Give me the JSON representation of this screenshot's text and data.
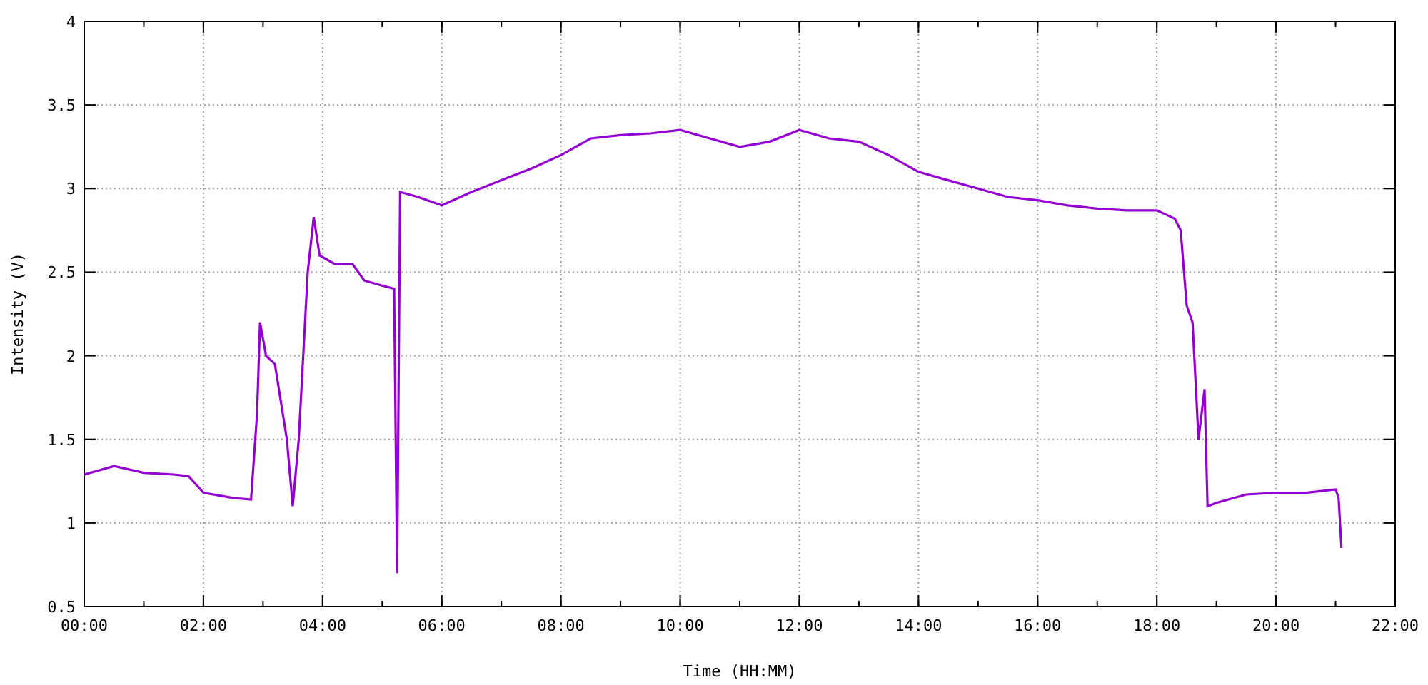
{
  "chart_data": {
    "type": "line",
    "grid": true,
    "xlabel": "Time (HH:MM)",
    "ylabel": "Intensity (V)",
    "x": [
      0,
      0.5,
      1,
      1.5,
      1.75,
      2,
      2.5,
      2.8,
      2.9,
      2.95,
      3.05,
      3.2,
      3.4,
      3.5,
      3.6,
      3.75,
      3.85,
      3.95,
      4.2,
      4.5,
      4.7,
      5,
      5.2,
      5.25,
      5.3,
      5.6,
      6,
      6.5,
      7,
      7.5,
      8,
      8.5,
      9,
      9.5,
      10,
      10.5,
      11,
      11.5,
      12,
      12.5,
      13,
      13.5,
      14,
      14.5,
      15,
      15.5,
      16,
      16.5,
      17,
      17.5,
      18,
      18.3,
      18.4,
      18.5,
      18.6,
      18.7,
      18.8,
      18.85,
      19,
      19.5,
      20,
      20.5,
      21,
      21.05,
      21.1
    ],
    "series": [
      {
        "color": "#9400d3",
        "values": [
          1.29,
          1.34,
          1.3,
          1.29,
          1.28,
          1.18,
          1.15,
          1.14,
          1.65,
          2.2,
          2,
          1.95,
          1.5,
          1.1,
          1.5,
          2.5,
          2.83,
          2.6,
          2.55,
          2.55,
          2.45,
          2.42,
          2.4,
          0.7,
          2.98,
          2.95,
          2.9,
          2.98,
          3.05,
          3.12,
          3.2,
          3.3,
          3.32,
          3.33,
          3.35,
          3.3,
          3.25,
          3.28,
          3.35,
          3.3,
          3.28,
          3.2,
          3.1,
          3.05,
          3,
          2.95,
          2.93,
          2.9,
          2.88,
          2.87,
          2.87,
          2.82,
          2.75,
          2.3,
          2.2,
          1.5,
          1.8,
          1.1,
          1.12,
          1.17,
          1.18,
          1.18,
          1.2,
          1.15,
          0.85
        ]
      }
    ],
    "xlim": [
      0,
      22
    ],
    "ylim": [
      0.5,
      4
    ],
    "xticks": [
      {
        "value": 0,
        "label": "00:00"
      },
      {
        "value": 2,
        "label": "02:00"
      },
      {
        "value": 4,
        "label": "04:00"
      },
      {
        "value": 6,
        "label": "06:00"
      },
      {
        "value": 8,
        "label": "08:00"
      },
      {
        "value": 10,
        "label": "10:00"
      },
      {
        "value": 12,
        "label": "12:00"
      },
      {
        "value": 14,
        "label": "14:00"
      },
      {
        "value": 16,
        "label": "16:00"
      },
      {
        "value": 18,
        "label": "18:00"
      },
      {
        "value": 20,
        "label": "20:00"
      },
      {
        "value": 22,
        "label": "22:00"
      }
    ],
    "yticks": [
      {
        "value": 0.5,
        "label": "0.5"
      },
      {
        "value": 1,
        "label": "1"
      },
      {
        "value": 1.5,
        "label": "1.5"
      },
      {
        "value": 2,
        "label": "2"
      },
      {
        "value": 2.5,
        "label": "2.5"
      },
      {
        "value": 3,
        "label": "3"
      },
      {
        "value": 3.5,
        "label": "3.5"
      },
      {
        "value": 4,
        "label": "4"
      }
    ]
  }
}
